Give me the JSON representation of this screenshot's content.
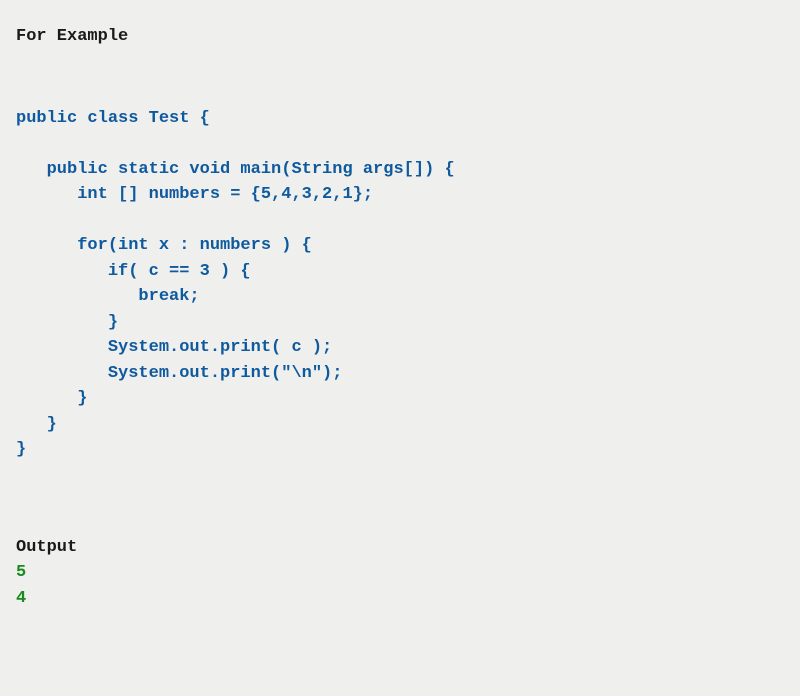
{
  "heading": "For Example",
  "code": "public class Test {\n\n   public static void main(String args[]) {\n      int [] numbers = {5,4,3,2,1};\n\n      for(int x : numbers ) {\n         if( c == 3 ) {\n            break;\n         }\n         System.out.print( c );\n         System.out.print(\"\\n\");\n      }\n   }\n}",
  "output_label": "Output",
  "output_values": [
    "5",
    "4"
  ]
}
